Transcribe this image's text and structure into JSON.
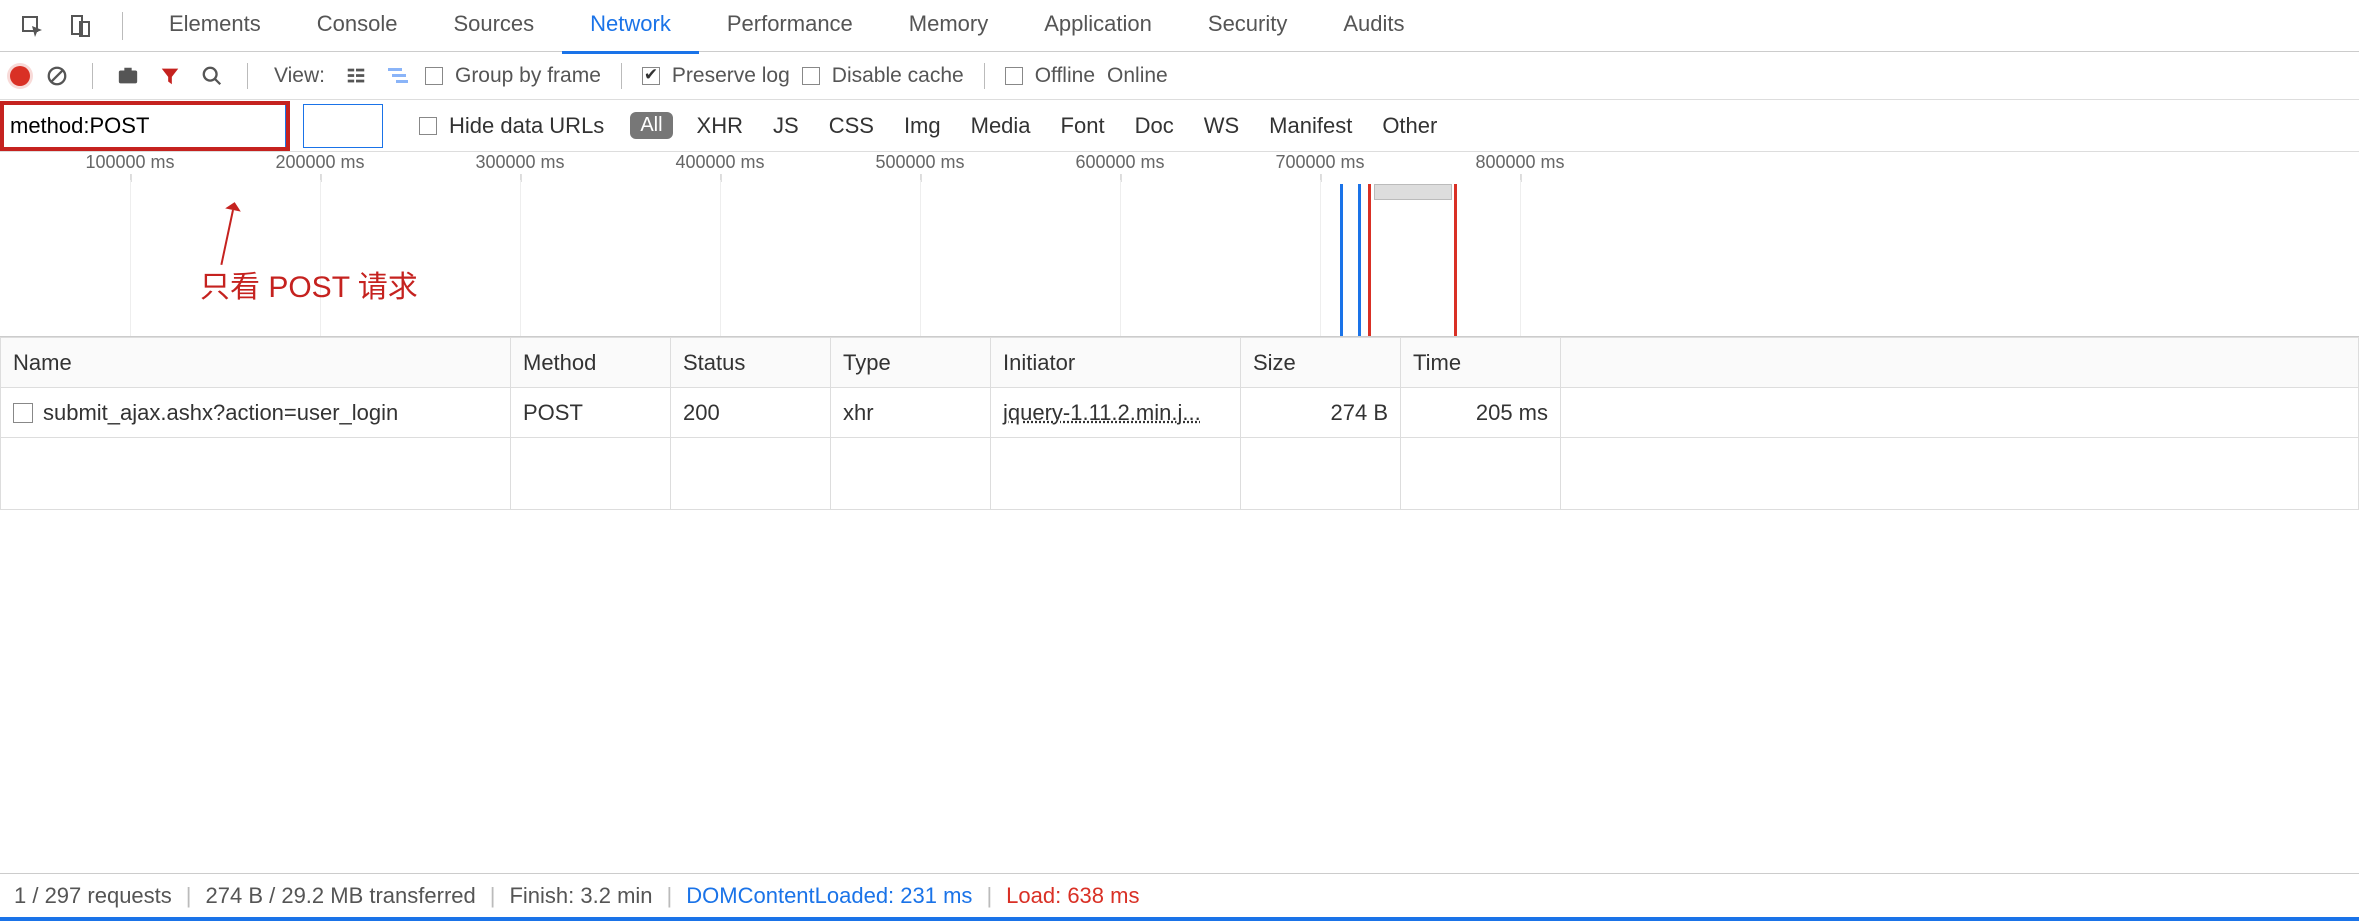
{
  "tabs": {
    "items": [
      "Elements",
      "Console",
      "Sources",
      "Network",
      "Performance",
      "Memory",
      "Application",
      "Security",
      "Audits"
    ],
    "active": "Network"
  },
  "toolbar": {
    "view_label": "View:",
    "group_by_frame": "Group by frame",
    "preserve_log": "Preserve log",
    "disable_cache": "Disable cache",
    "offline": "Offline",
    "online": "Online"
  },
  "filter": {
    "value": "method:POST",
    "hide_data_urls": "Hide data URLs",
    "types": [
      "All",
      "XHR",
      "JS",
      "CSS",
      "Img",
      "Media",
      "Font",
      "Doc",
      "WS",
      "Manifest",
      "Other"
    ],
    "active_type": "All"
  },
  "timeline": {
    "ticks": [
      "100000 ms",
      "200000 ms",
      "300000 ms",
      "400000 ms",
      "500000 ms",
      "600000 ms",
      "700000 ms",
      "800000 ms"
    ]
  },
  "annotation": {
    "text": "只看 POST 请求"
  },
  "table": {
    "columns": [
      "Name",
      "Method",
      "Status",
      "Type",
      "Initiator",
      "Size",
      "Time"
    ],
    "rows": [
      {
        "name": "submit_ajax.ashx?action=user_login",
        "method": "POST",
        "status": "200",
        "type": "xhr",
        "initiator": "jquery-1.11.2.min.j...",
        "size": "274 B",
        "time": "205 ms"
      }
    ]
  },
  "status": {
    "requests": "1 / 297 requests",
    "transferred": "274 B / 29.2 MB transferred",
    "finish": "Finish: 3.2 min",
    "dom": "DOMContentLoaded: 231 ms",
    "load": "Load: 638 ms"
  }
}
